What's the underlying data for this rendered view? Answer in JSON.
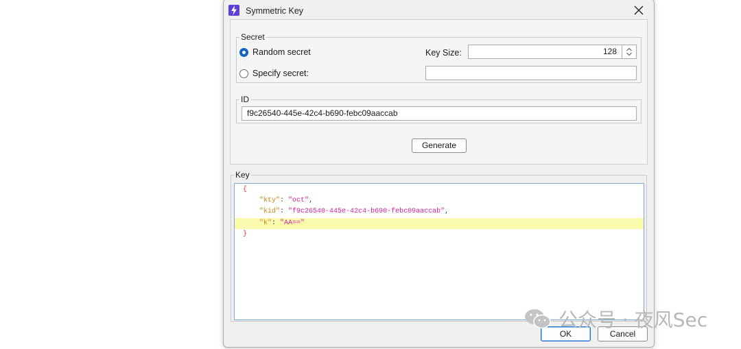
{
  "dialog": {
    "title": "Symmetric Key",
    "secret_group": {
      "legend": "Secret",
      "random_secret_label": "Random secret",
      "specify_secret_label": "Specify secret:",
      "random_selected": true,
      "key_size_label": "Key Size:",
      "key_size_value": "128",
      "specify_secret_value": ""
    },
    "id_group": {
      "legend": "ID",
      "id_value": "f9c26540-445e-42c4-b690-febc09aaccab"
    },
    "generate_label": "Generate",
    "key_group": {
      "legend": "Key",
      "json_lines": [
        {
          "open": "{"
        },
        {
          "key": "\"kty\"",
          "value": "\"oct\"",
          "trail": ","
        },
        {
          "key": "\"kid\"",
          "value": "\"f9c26540-445e-42c4-b690-febc09aaccab\"",
          "trail": ","
        },
        {
          "key": "\"k\"",
          "value": "\"AA==\"",
          "trail": ""
        },
        {
          "close": "}"
        }
      ],
      "highlighted_line": 3
    },
    "ok_label": "OK",
    "cancel_label": "Cancel"
  },
  "watermark": {
    "text": "公众号 · 夜风Sec"
  },
  "colors": {
    "accent": "#1565c0",
    "icon_bg": "#5b3fd6",
    "json_key": "#c8860d",
    "json_string": "#d01fa4",
    "json_brace": "#e03030",
    "line_highlight": "#fbfbb0"
  }
}
